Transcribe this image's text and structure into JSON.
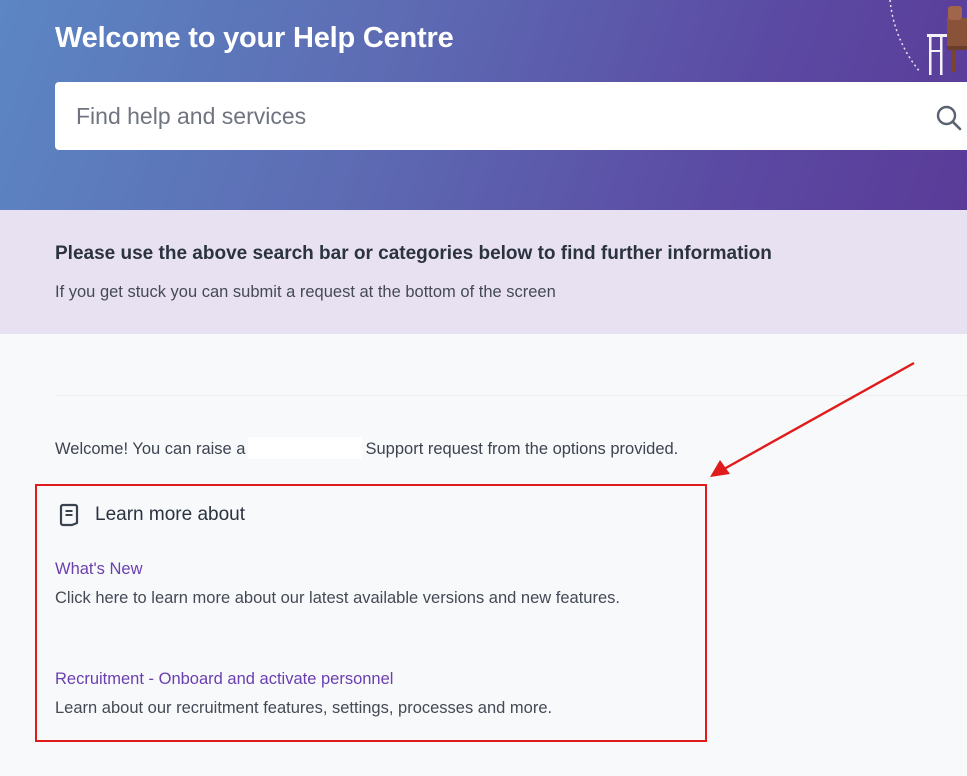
{
  "hero": {
    "title": "Welcome to your Help Centre",
    "background_from": "#5c86c4",
    "background_to": "#5a3b98"
  },
  "search": {
    "placeholder": "Find help and services",
    "value": "",
    "icon": "search-icon"
  },
  "notice": {
    "heading": "Please use the above search bar or categories below to find further information",
    "text": "If you get stuck you can submit a request at the bottom of the screen",
    "background": "#e8e1f1"
  },
  "welcome": {
    "before": "Welcome! You can raise a",
    "after": "Support request from the options provided."
  },
  "learn_more": {
    "heading": "Learn more about",
    "icon": "article-icon",
    "articles": [
      {
        "title": "What's New",
        "description": "Click here to learn more about our latest available versions and new features."
      },
      {
        "title": "Recruitment - Onboard and activate personnel",
        "description": "Learn about our recruitment features, settings, processes and more."
      }
    ]
  },
  "colors": {
    "link": "#6a3fb0",
    "annotation": "#e01b1b"
  }
}
